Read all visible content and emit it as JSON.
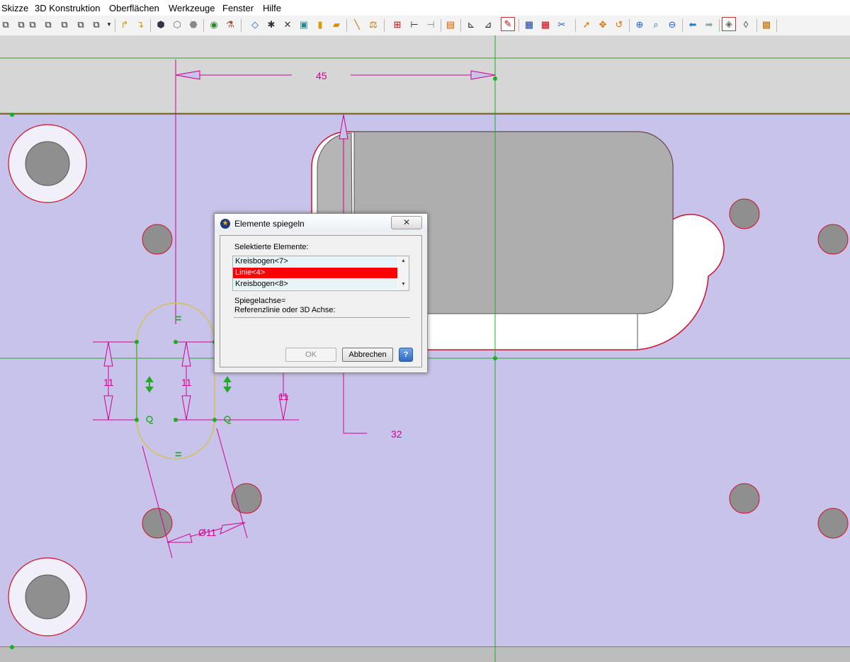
{
  "menu": {
    "items": [
      "Skizze",
      "3D Konstruktion",
      "Oberflächen",
      "Werkzeuge",
      "Fenster",
      "Hilfe"
    ]
  },
  "toolbar": {
    "icons": [
      "cube-icon",
      "cube-icon",
      "cube-icon",
      "cube-icon",
      "cube-icon",
      "cube-icon",
      "cube-icon",
      "dropdown-arrow-icon",
      "extrude-icon",
      "revolve-icon",
      "solid-icon",
      "solid-icon",
      "solid-icon",
      "visibility-icon",
      "flask-icon",
      "plane-icon",
      "point-icon",
      "point-icon",
      "image-icon",
      "book-icon",
      "bag-icon",
      "ruler-icon",
      "balance-icon",
      "dimension-icon",
      "dimension-icon",
      "dimension-icon",
      "document-icon",
      "constraint-icon",
      "constraint-icon",
      "sketch-icon",
      "grid-icon",
      "grid-icon",
      "magic-icon",
      "select-arrow-icon",
      "move-icon",
      "undo-rotate-icon",
      "zoom-in-icon",
      "zoom-fit-icon",
      "zoom-out-icon",
      "back-arrow-icon",
      "forward-arrow-icon",
      "shaded-view-icon",
      "wireframe-view-icon",
      "box-icon"
    ]
  },
  "colors": {
    "part_face": "#c8c3ea",
    "upper_face": "#d6d6d6",
    "dimension": "#d4008f",
    "constraint": "#22aa22",
    "slot_outline": "#d2c258",
    "hole_fill": "#8f8f8f",
    "edge": "#d0112b",
    "selection": "#ff0000"
  },
  "drawing": {
    "dimensions": [
      "45",
      "11",
      "11",
      "11",
      "32",
      "Ø11"
    ],
    "constraint_symbols": [
      "=",
      "="
    ]
  },
  "dialog": {
    "title": "Elemente spiegeln",
    "close_label": "✕",
    "selected_label": "Selektierte Elemente:",
    "list": [
      "Kreisbogen<7>",
      "Linie<4>",
      "Kreisbogen<8>"
    ],
    "selected_index": 1,
    "axis_label": "Spiegelachse=",
    "axis_hint": "Referenzlinie oder 3D Achse:",
    "ok_label": "OK",
    "cancel_label": "Abbrechen",
    "help_label": "?"
  }
}
